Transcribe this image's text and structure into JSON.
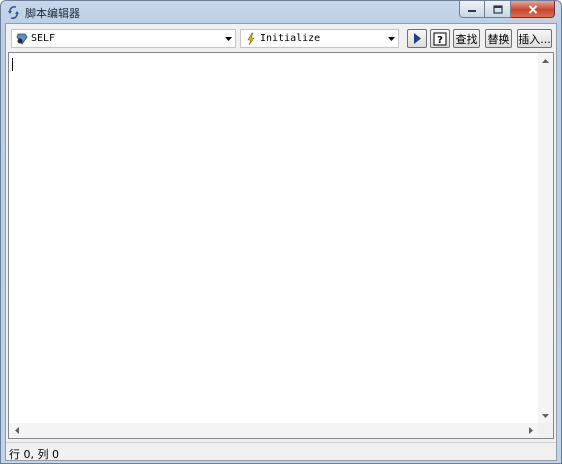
{
  "window": {
    "title": "脚本编辑器"
  },
  "toolbar": {
    "object_combo": {
      "value": "SELF",
      "icon": "object-icon"
    },
    "event_combo": {
      "value": "Initialize",
      "icon": "lightning-icon"
    },
    "run_icon": "play-icon",
    "help_icon": "help-icon",
    "find_label": "查找",
    "replace_label": "替换",
    "insert_label": "插入..."
  },
  "editor": {
    "content": ""
  },
  "status": {
    "position_text": "行 0, 列 0"
  }
}
